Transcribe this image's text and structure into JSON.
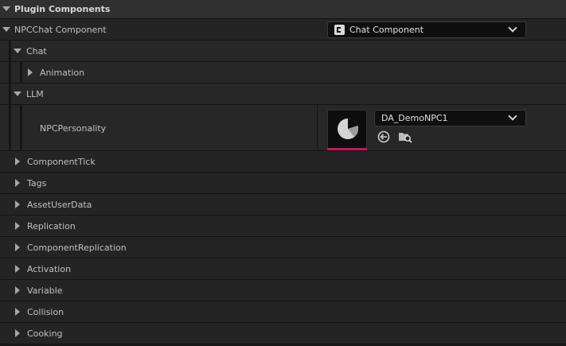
{
  "panel": {
    "title": "Plugin Components"
  },
  "component": {
    "label": "NPCChat Component",
    "class_select": {
      "value": "Chat Component",
      "icon": "component-icon"
    }
  },
  "categories": {
    "chat": {
      "label": "Chat"
    },
    "animation": {
      "label": "Animation"
    },
    "llm": {
      "label": "LLM"
    }
  },
  "npc_personality": {
    "label": "NPCPersonality",
    "asset_select": {
      "value": "DA_DemoNPC1"
    },
    "thumbnail_icon": "data-asset-icon",
    "accent": "#c2185b",
    "use_selected_icon": "use-selected-asset-icon",
    "browse_icon": "browse-in-content-browser-icon"
  },
  "collapsed_categories": [
    "ComponentTick",
    "Tags",
    "AssetUserData",
    "Replication",
    "ComponentReplication",
    "Activation",
    "Variable",
    "Collision",
    "Cooking"
  ]
}
